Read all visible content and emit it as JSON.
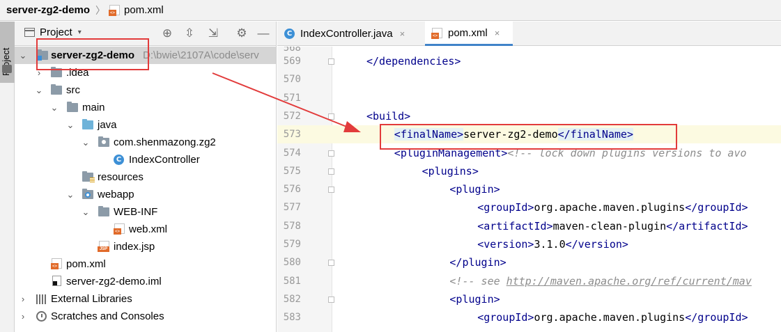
{
  "breadcrumb": {
    "project": "server-zg2-demo",
    "separator": "〉",
    "file": "pom.xml"
  },
  "toolstrip": {
    "project_tab_label": "Project"
  },
  "project_panel": {
    "title": "Project",
    "dropdown_caret": "▾",
    "actions": {
      "locate": "⊕",
      "expand": "⇳",
      "collapse": "⇲",
      "settings": "⚙",
      "hide": "—"
    },
    "tree": [
      {
        "label": "server-zg2-demo",
        "path": "D:\\bwie\\2107A\\code\\serv",
        "chevron": "⌄",
        "icon": "module-folder-icon",
        "bold": true
      },
      {
        "label": ".idea",
        "chevron": "›",
        "icon": "folder-icon"
      },
      {
        "label": "src",
        "chevron": "⌄",
        "icon": "folder-icon"
      },
      {
        "label": "main",
        "chevron": "⌄",
        "icon": "folder-icon"
      },
      {
        "label": "java",
        "chevron": "⌄",
        "icon": "source-folder-icon"
      },
      {
        "label": "com.shenmazong.zg2",
        "chevron": "⌄",
        "icon": "package-icon"
      },
      {
        "label": "IndexController",
        "chevron": "",
        "icon": "class-icon"
      },
      {
        "label": "resources",
        "chevron": "",
        "icon": "resources-folder-icon"
      },
      {
        "label": "webapp",
        "chevron": "⌄",
        "icon": "web-folder-icon"
      },
      {
        "label": "WEB-INF",
        "chevron": "⌄",
        "icon": "folder-icon"
      },
      {
        "label": "web.xml",
        "chevron": "",
        "icon": "web-xml-icon"
      },
      {
        "label": "index.jsp",
        "chevron": "",
        "icon": "jsp-file-icon"
      },
      {
        "label": "pom.xml",
        "chevron": "",
        "icon": "maven-xml-icon"
      },
      {
        "label": "server-zg2-demo.iml",
        "chevron": "",
        "icon": "iml-file-icon"
      },
      {
        "label": "External Libraries",
        "chevron": "›",
        "icon": "libraries-icon"
      },
      {
        "label": "Scratches and Consoles",
        "chevron": "›",
        "icon": "scratches-icon"
      }
    ]
  },
  "editor": {
    "tabs": [
      {
        "label": "IndexController.java",
        "icon": "class-icon",
        "close": "×",
        "active": false
      },
      {
        "label": "pom.xml",
        "icon": "maven-xml-icon",
        "close": "×",
        "active": true
      }
    ],
    "ghost_line_number": "568",
    "lines": [
      {
        "num": "569",
        "indent": 1,
        "fold": true,
        "tokens": [
          [
            "tag",
            "</dependencies>"
          ]
        ]
      },
      {
        "num": "570",
        "indent": 0,
        "fold": false,
        "tokens": []
      },
      {
        "num": "571",
        "indent": 0,
        "fold": false,
        "tokens": []
      },
      {
        "num": "572",
        "indent": 1,
        "fold": true,
        "tokens": [
          [
            "tag",
            "<build>"
          ]
        ]
      },
      {
        "num": "573",
        "indent": 2,
        "fold": false,
        "current": true,
        "tokens": [
          [
            "taghl",
            "<finalName>"
          ],
          [
            "text",
            "server-zg2-demo"
          ],
          [
            "taghl",
            "</finalName>"
          ]
        ]
      },
      {
        "num": "574",
        "indent": 2,
        "fold": true,
        "tokens": [
          [
            "tag",
            "<pluginManagement>"
          ],
          [
            "cm",
            "<!-- lock down plugins versions to avo"
          ]
        ]
      },
      {
        "num": "575",
        "indent": 3,
        "fold": true,
        "tokens": [
          [
            "tag",
            "<plugins>"
          ]
        ]
      },
      {
        "num": "576",
        "indent": 4,
        "fold": true,
        "tokens": [
          [
            "tag",
            "<plugin>"
          ]
        ]
      },
      {
        "num": "577",
        "indent": 5,
        "fold": false,
        "tokens": [
          [
            "tag",
            "<groupId>"
          ],
          [
            "text",
            "org.apache.maven.plugins"
          ],
          [
            "tag",
            "</groupId>"
          ]
        ]
      },
      {
        "num": "578",
        "indent": 5,
        "fold": false,
        "tokens": [
          [
            "tag",
            "<artifactId>"
          ],
          [
            "text",
            "maven-clean-plugin"
          ],
          [
            "tag",
            "</artifactId>"
          ]
        ]
      },
      {
        "num": "579",
        "indent": 5,
        "fold": false,
        "tokens": [
          [
            "tag",
            "<version>"
          ],
          [
            "text",
            "3.1.0"
          ],
          [
            "tag",
            "</version>"
          ]
        ]
      },
      {
        "num": "580",
        "indent": 4,
        "fold": true,
        "tokens": [
          [
            "tag",
            "</plugin>"
          ]
        ]
      },
      {
        "num": "581",
        "indent": 4,
        "fold": false,
        "tokens": [
          [
            "cm",
            "<!-- see "
          ],
          [
            "cmlink",
            "http://maven.apache.org/ref/current/mav"
          ]
        ]
      },
      {
        "num": "582",
        "indent": 4,
        "fold": true,
        "tokens": [
          [
            "tag",
            "<plugin>"
          ]
        ]
      },
      {
        "num": "583",
        "indent": 5,
        "fold": false,
        "tokens": [
          [
            "tag",
            "<groupId>"
          ],
          [
            "text",
            "org.apache.maven.plugins"
          ],
          [
            "tag",
            "</groupId>"
          ]
        ]
      }
    ]
  },
  "colors": {
    "annotation_red": "#e23b3b",
    "tag_blue": "#00008b",
    "tab_underline": "#4083c9",
    "current_line": "#fcfae1"
  }
}
